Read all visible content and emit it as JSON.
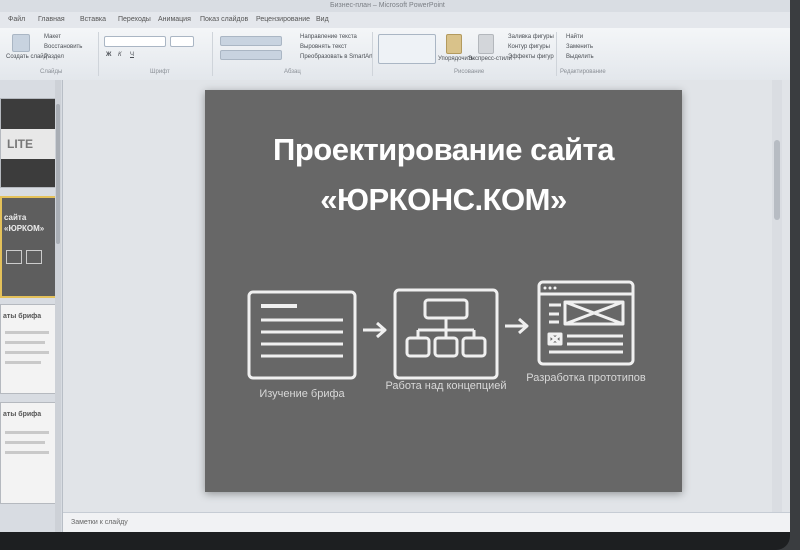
{
  "window": {
    "title": "Бизнес-план – Microsoft PowerPoint"
  },
  "tabs": [
    "Файл",
    "Главная",
    "Вставка",
    "Переходы",
    "Анимация",
    "Показ слайдов",
    "Рецензирование",
    "Вид"
  ],
  "ribbon": {
    "new_slide": "Создать слайд",
    "layout": "Макет",
    "reset": "Восстановить",
    "section": "Раздел",
    "groups": [
      "Слайды",
      "Шрифт",
      "Абзац",
      "Рисование",
      "Редактирование"
    ],
    "text_direction": "Направление текста",
    "align_text": "Выровнять текст",
    "smartart": "Преобразовать в SmartArt",
    "arrange": "Упорядочить",
    "quick_styles": "Экспресс-стили",
    "shape_fill": "Заливка фигуры",
    "shape_outline": "Контур фигуры",
    "shape_effects": "Эффекты фигур",
    "find": "Найти",
    "replace": "Заменить",
    "select": "Выделить"
  },
  "thumbnails": [
    {
      "text": "LITE"
    },
    {
      "text": "сайта «ЮРКОМ»"
    },
    {
      "text": "аты брифа"
    },
    {
      "text": "аты брифа"
    }
  ],
  "slide": {
    "title_line1": "Проектирование сайта",
    "title_line2": "«ЮРКОНС.КОМ»",
    "steps": [
      "Изучение брифа",
      "Работа над концепцией",
      "Разработка прототипов"
    ]
  },
  "notes": {
    "placeholder": "Заметки к слайду"
  }
}
